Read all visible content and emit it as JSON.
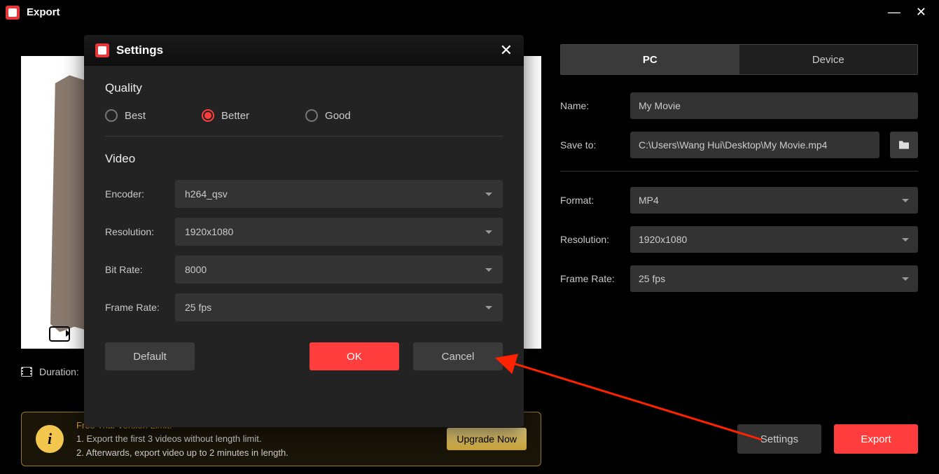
{
  "titlebar": {
    "title": "Export"
  },
  "duration_label": "Duration:",
  "tabs": {
    "pc": "PC",
    "device": "Device"
  },
  "form": {
    "name_label": "Name:",
    "name_value": "My Movie",
    "save_label": "Save to:",
    "save_value": "C:\\Users\\Wang Hui\\Desktop\\My Movie.mp4",
    "format_label": "Format:",
    "format_value": "MP4",
    "resolution_label": "Resolution:",
    "resolution_value": "1920x1080",
    "framerate_label": "Frame Rate:",
    "framerate_value": "25 fps"
  },
  "trial": {
    "heading": "Free Trial Version Limit.",
    "line1": "1. Export the first 3 videos without length limit.",
    "line2": "2. Afterwards, export video up to 2 minutes in length.",
    "upgrade": "Upgrade Now"
  },
  "buttons": {
    "settings": "Settings",
    "export": "Export"
  },
  "modal": {
    "title": "Settings",
    "quality_section": "Quality",
    "quality_options": {
      "best": "Best",
      "better": "Better",
      "good": "Good"
    },
    "quality_selected": "Better",
    "video_section": "Video",
    "encoder_label": "Encoder:",
    "encoder_value": "h264_qsv",
    "resolution_label": "Resolution:",
    "resolution_value": "1920x1080",
    "bitrate_label": "Bit Rate:",
    "bitrate_value": "8000",
    "framerate_label": "Frame Rate:",
    "framerate_value": "25 fps",
    "default_btn": "Default",
    "ok_btn": "OK",
    "cancel_btn": "Cancel"
  }
}
